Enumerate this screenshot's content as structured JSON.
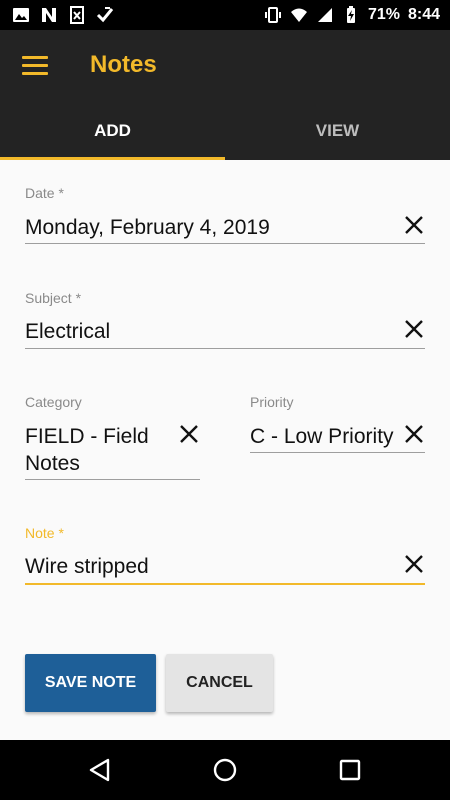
{
  "status_bar": {
    "left_icons": [
      "image-icon",
      "n-app-icon",
      "sheet-x-icon",
      "check-flag-icon"
    ],
    "right_icons": [
      "vibrate-icon",
      "wifi-icon",
      "signal-icon",
      "battery-charging-icon"
    ],
    "battery_percent": "71%",
    "time": "8:44"
  },
  "app_bar": {
    "menu_icon": "hamburger-menu-icon",
    "title": "Notes"
  },
  "tabs": [
    {
      "label": "ADD",
      "selected": true
    },
    {
      "label": "VIEW",
      "selected": false
    }
  ],
  "form": {
    "date": {
      "label": "Date *",
      "value": "Monday, February 4, 2019"
    },
    "subject": {
      "label": "Subject *",
      "value": "Electrical"
    },
    "category": {
      "label": "Category",
      "value": "FIELD - Field Notes"
    },
    "priority": {
      "label": "Priority",
      "value": "C - Low Priority"
    },
    "note": {
      "label": "Note *",
      "value": "Wire stripped",
      "focused": true
    }
  },
  "buttons": {
    "save_label": "SAVE NOTE",
    "cancel_label": "CANCEL"
  },
  "nav_bar": {
    "icons": [
      "back-icon",
      "home-icon",
      "recents-icon"
    ]
  },
  "colors": {
    "accent": "#f2b92a",
    "app_bar": "#232323",
    "primary_button": "#1e5f98"
  }
}
